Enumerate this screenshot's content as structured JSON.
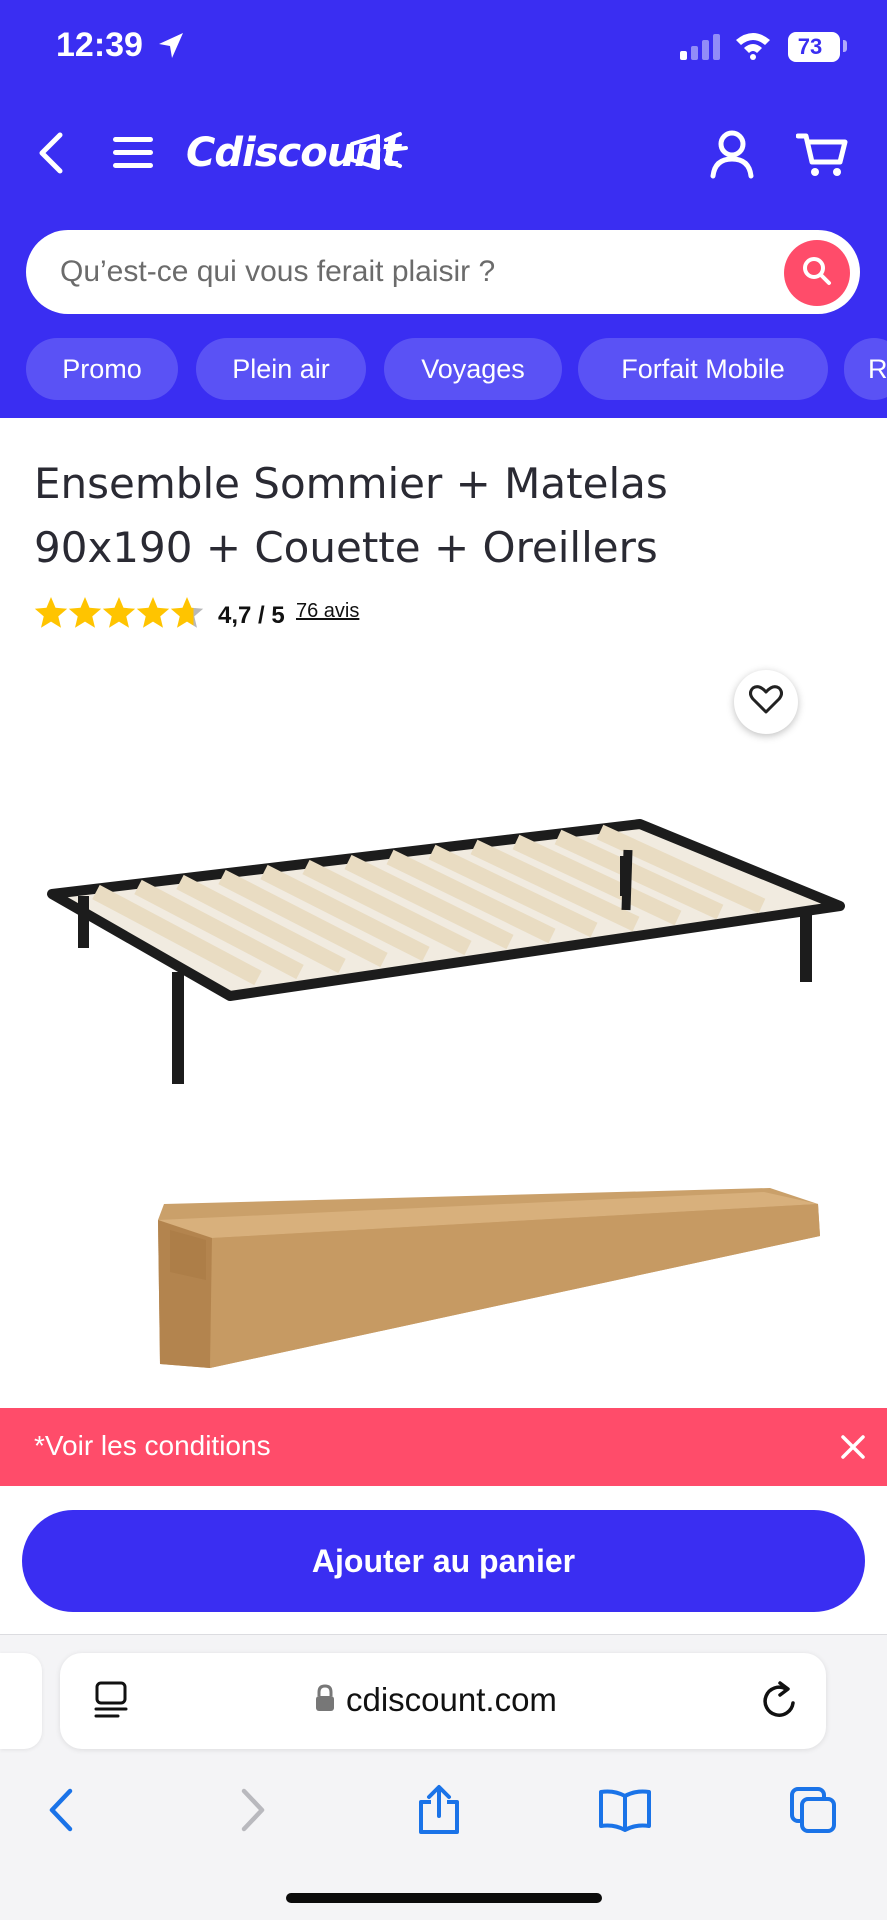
{
  "status_bar": {
    "time": "12:39",
    "battery": "73",
    "icons": [
      "location-arrow-icon",
      "cellular-signal-icon",
      "wifi-icon",
      "battery-icon"
    ]
  },
  "header": {
    "logo_text": "Cdiscount",
    "icons": [
      "back-icon",
      "hamburger-menu-icon",
      "account-icon",
      "cart-icon"
    ]
  },
  "search": {
    "placeholder": "Qu’est-ce qui vous ferait plaisir ?",
    "icon": "search-icon"
  },
  "chips": [
    {
      "label": "Promo"
    },
    {
      "label": "Plein air"
    },
    {
      "label": "Voyages"
    },
    {
      "label": "Forfait Mobile"
    },
    {
      "label": "R"
    }
  ],
  "product": {
    "title_line1": "Ensemble Sommier + Matelas",
    "title_line2": "90x190 + Couette + Oreillers",
    "rating_value": "4,7 / 5",
    "rating_count": "76 avis",
    "rating_fraction": 0.94,
    "favorite_icon": "heart-icon"
  },
  "conditions": {
    "text": "*Voir les conditions",
    "close_icon": "close-icon"
  },
  "cart": {
    "button_label": "Ajouter au panier"
  },
  "browser": {
    "url": "cdiscount.com",
    "icons": [
      "reader-icon",
      "lock-icon",
      "reload-icon",
      "back-arrow-icon",
      "forward-arrow-icon",
      "share-icon",
      "bookmarks-icon",
      "tabs-icon"
    ]
  },
  "colors": {
    "brand_blue": "#3a2ef2",
    "chip_blue": "#5a52f5",
    "accent_pink": "#ff4c6a",
    "star_yellow": "#ffc400",
    "ios_blue": "#1a73e8"
  }
}
